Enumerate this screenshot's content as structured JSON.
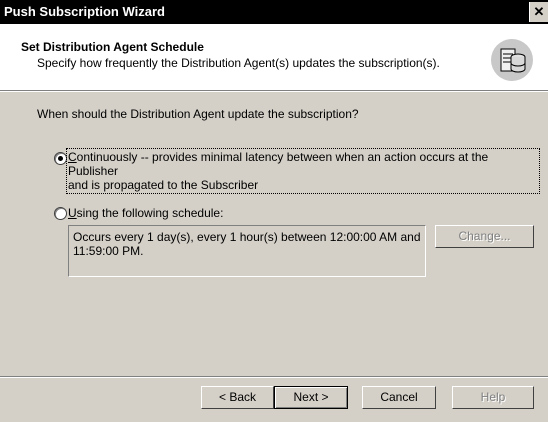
{
  "window": {
    "title": "Push Subscription Wizard",
    "close_glyph": "✕"
  },
  "header": {
    "title": "Set Distribution Agent Schedule",
    "subtitle": "Specify how frequently the Distribution Agent(s) updates the subscription(s).",
    "icon": "database-server-icon"
  },
  "main": {
    "question": "When should the Distribution Agent update the subscription?",
    "options": [
      {
        "label_first": "C",
        "label_rest": "ontinuously -- provides minimal latency between when an action occurs at the Publisher",
        "label_line2": "and is propagated to the Subscriber",
        "selected": true
      },
      {
        "label_first": "U",
        "label_rest": "sing the following schedule:",
        "selected": false
      }
    ],
    "schedule_text": "Occurs every 1 day(s), every 1 hour(s) between 12:00:00 AM and 11:59:00 PM.",
    "change_button": "Change..."
  },
  "footer": {
    "back_label": "< Back",
    "next_label": "Next >",
    "cancel_label": "Cancel",
    "help_label": "Help"
  }
}
